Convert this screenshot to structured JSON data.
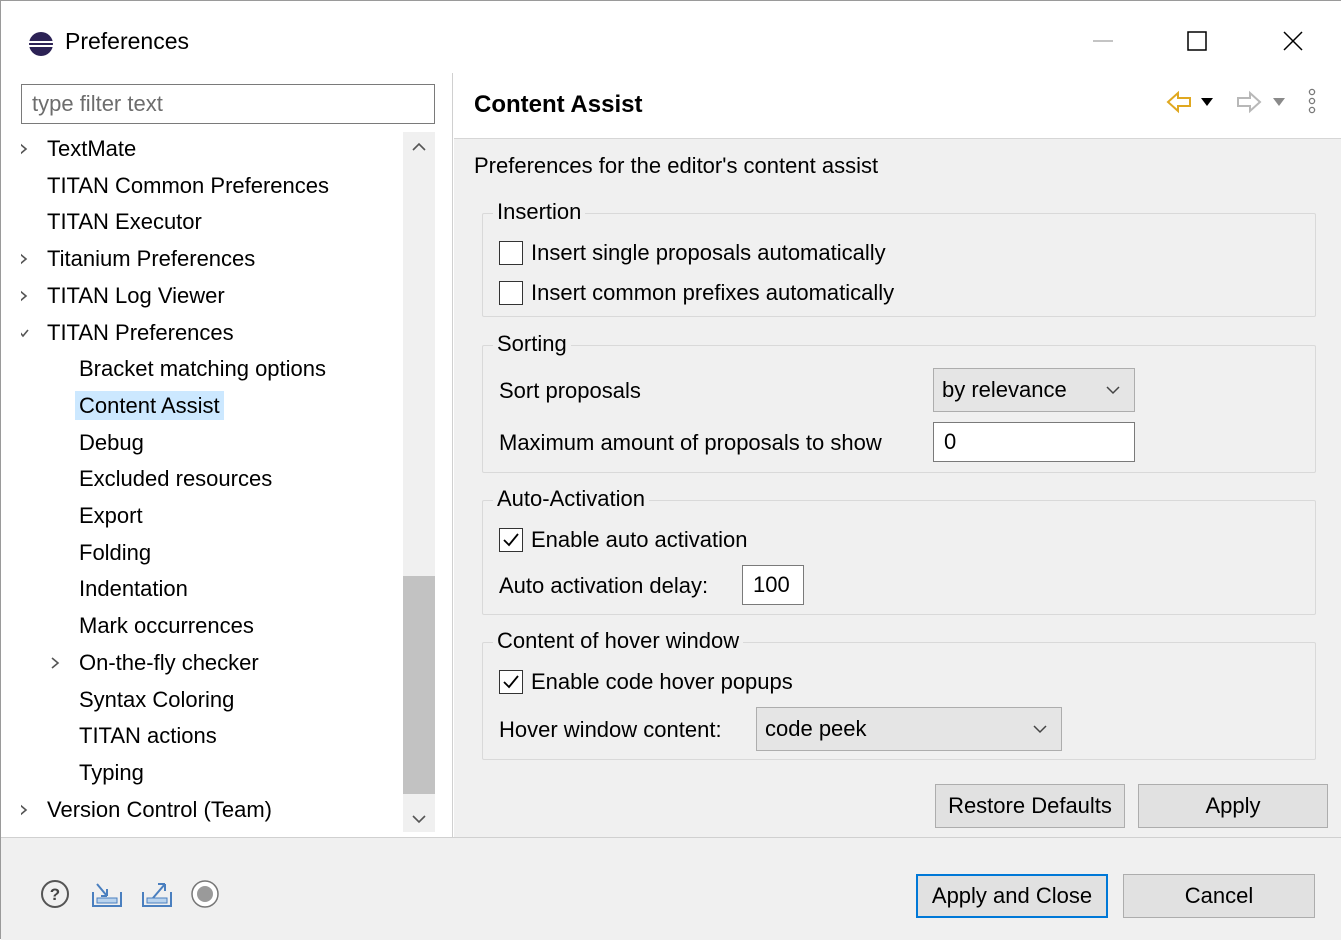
{
  "window": {
    "title": "Preferences"
  },
  "filter": {
    "placeholder": "type filter text"
  },
  "tree": [
    {
      "label": "TextMate",
      "level": 0,
      "twisty": "collapsed"
    },
    {
      "label": "TITAN Common Preferences",
      "level": 0,
      "twisty": "none"
    },
    {
      "label": "TITAN Executor",
      "level": 0,
      "twisty": "none"
    },
    {
      "label": "Titanium Preferences",
      "level": 0,
      "twisty": "collapsed"
    },
    {
      "label": "TITAN Log Viewer",
      "level": 0,
      "twisty": "collapsed"
    },
    {
      "label": "TITAN Preferences",
      "level": 0,
      "twisty": "expanded"
    },
    {
      "label": "Bracket matching options",
      "level": 1,
      "twisty": "none"
    },
    {
      "label": "Content Assist",
      "level": 1,
      "twisty": "none",
      "selected": true
    },
    {
      "label": "Debug",
      "level": 1,
      "twisty": "none"
    },
    {
      "label": "Excluded resources",
      "level": 1,
      "twisty": "none"
    },
    {
      "label": "Export",
      "level": 1,
      "twisty": "none"
    },
    {
      "label": "Folding",
      "level": 1,
      "twisty": "none"
    },
    {
      "label": "Indentation",
      "level": 1,
      "twisty": "none"
    },
    {
      "label": "Mark occurrences",
      "level": 1,
      "twisty": "none"
    },
    {
      "label": "On-the-fly checker",
      "level": 1,
      "twisty": "collapsed"
    },
    {
      "label": "Syntax Coloring",
      "level": 1,
      "twisty": "none"
    },
    {
      "label": "TITAN actions",
      "level": 1,
      "twisty": "none"
    },
    {
      "label": "Typing",
      "level": 1,
      "twisty": "none"
    },
    {
      "label": "Version Control (Team)",
      "level": 0,
      "twisty": "collapsed"
    }
  ],
  "page": {
    "title": "Content Assist",
    "description": "Preferences for the editor's content assist",
    "insertion": {
      "title": "Insertion",
      "single_label": "Insert single proposals automatically",
      "single_checked": false,
      "prefix_label": "Insert common prefixes automatically",
      "prefix_checked": false
    },
    "sorting": {
      "title": "Sorting",
      "sort_label": "Sort proposals",
      "sort_value": "by relevance",
      "max_label": "Maximum amount of proposals to show",
      "max_value": "0"
    },
    "auto_activation": {
      "title": "Auto-Activation",
      "enable_label": "Enable auto activation",
      "enable_checked": true,
      "delay_label": "Auto activation delay:",
      "delay_value": "100"
    },
    "hover": {
      "title": "Content of hover window",
      "enable_label": "Enable code hover popups",
      "enable_checked": true,
      "content_label": "Hover window content:",
      "content_value": "code peek"
    },
    "restore_label": "Restore Defaults",
    "apply_label": "Apply"
  },
  "footer": {
    "apply_close_label": "Apply and Close",
    "cancel_label": "Cancel"
  },
  "icons": {
    "app": "eclipse-icon",
    "help": "help-icon",
    "import": "import-icon",
    "export": "export-icon",
    "oomph": "record-icon"
  },
  "colors": {
    "selection": "#cce8ff",
    "default_button_border": "#0078d7",
    "nav_arrow": "#e8b020",
    "dialog_bg": "#f0f0f0"
  }
}
